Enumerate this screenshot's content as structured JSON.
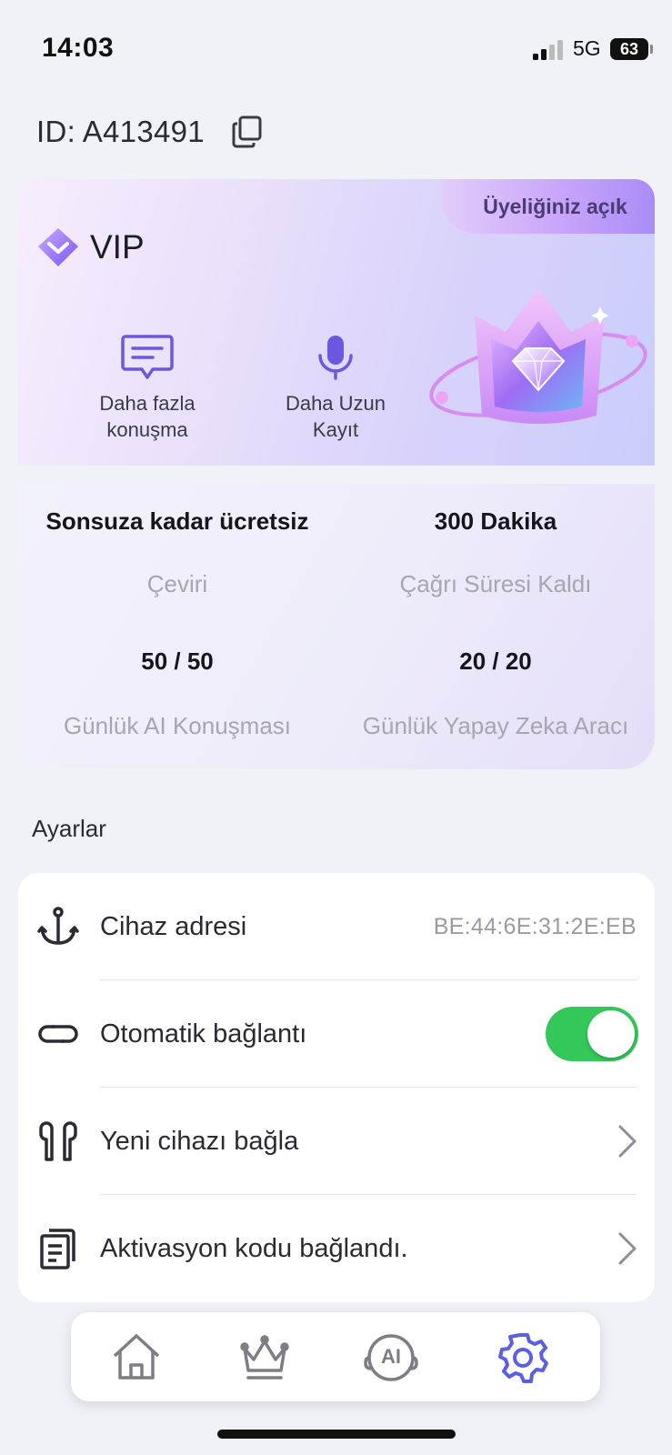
{
  "status_bar": {
    "time": "14:03",
    "network": "5G",
    "battery": "63"
  },
  "account": {
    "id_text": "ID: A413491"
  },
  "vip": {
    "badge": "Üyeliğiniz açık",
    "title": "VIP",
    "features": [
      {
        "icon": "chat-bubble-icon",
        "label_line1": "Daha fazla",
        "label_line2": "konuşma"
      },
      {
        "icon": "microphone-icon",
        "label_line1": "Daha Uzun",
        "label_line2": "Kayıt"
      }
    ]
  },
  "stats": [
    {
      "value": "Sonsuza kadar ücretsiz",
      "caption": "Çeviri"
    },
    {
      "value": "300 Dakika",
      "caption": "Çağrı Süresi Kaldı"
    },
    {
      "value": "50 / 50",
      "caption": "Günlük AI Konuşması"
    },
    {
      "value": "20 / 20",
      "caption": "Günlük Yapay Zeka Aracı"
    }
  ],
  "settings": {
    "heading": "Ayarlar",
    "items": [
      {
        "icon": "anchor-icon",
        "label": "Cihaz adresi",
        "value": "BE:44:6E:31:2E:EB"
      },
      {
        "icon": "link-icon",
        "label": "Otomatik bağlantı",
        "toggle_on": true
      },
      {
        "icon": "earbuds-icon",
        "label": "Yeni cihazı bağla"
      },
      {
        "icon": "document-icon",
        "label": "Aktivasyon kodu bağlandı."
      }
    ]
  },
  "bottom_nav": {
    "items": [
      {
        "icon": "home-icon",
        "active": false
      },
      {
        "icon": "crown-icon",
        "active": false
      },
      {
        "icon": "ai-icon",
        "icon_text": "AI",
        "active": false
      },
      {
        "icon": "gear-icon",
        "active": true
      }
    ]
  },
  "colors": {
    "accent": "#5b5fe0",
    "toggle_on": "#34c759",
    "vip_purple": "#8a6cf0"
  }
}
